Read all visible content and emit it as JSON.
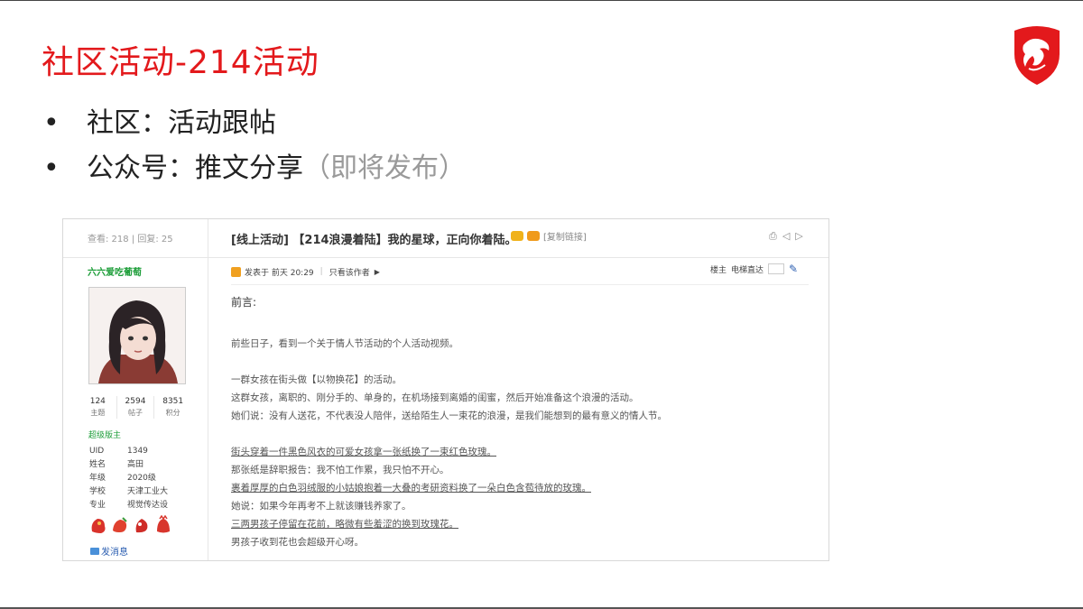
{
  "slide": {
    "title": "社区活动-214活动",
    "bullets": [
      {
        "main": "社区：活动跟帖",
        "muted": ""
      },
      {
        "main": "公众号：推文分享",
        "muted": "（即将发布）"
      }
    ],
    "accent_color": "#e3191c",
    "logo_icon": "msi-dragon-shield-icon"
  },
  "forum": {
    "stats": "查看: 218 | 回复: 25",
    "thread_title": "[线上活动] 【214浪漫着陆】我的星球，正向你着陆。",
    "copy_link": "[复制链接]",
    "author": "六六爱吃葡萄",
    "user_stats": [
      {
        "num": "124",
        "label": "主题"
      },
      {
        "num": "2594",
        "label": "帖子"
      },
      {
        "num": "8351",
        "label": "积分"
      }
    ],
    "rank": "超级版主",
    "profile": [
      {
        "key": "UID",
        "val": "1349"
      },
      {
        "key": "姓名",
        "val": "高田"
      },
      {
        "key": "年级",
        "val": "2020级"
      },
      {
        "key": "学校",
        "val": "天津工业大"
      },
      {
        "key": "专业",
        "val": "视觉传达设"
      }
    ],
    "send_message": "发消息",
    "posted": "发表于 前天 20:29",
    "only_author": "只看该作者",
    "floor": "楼主",
    "jump": "电梯直达",
    "content": {
      "foreword": "前言:",
      "paragraphs": [
        [
          "前些日子，看到一个关于情人节活动的个人活动视频。"
        ],
        [
          "一群女孩在街头做【以物换花】的活动。",
          "这群女孩，离职的、刚分手的、单身的，在机场接到离婚的闺蜜，然后开始准备这个浪漫的活动。",
          "她们说：没有人送花，不代表没人陪伴，送给陌生人一束花的浪漫，是我们能想到的最有意义的情人节。"
        ]
      ],
      "stories": [
        {
          "text": "街头穿着一件黑色风衣的可爱女孩拿一张纸换了一束红色玫瑰。",
          "underline": true
        },
        {
          "text": "那张纸是辞职报告：我不怕工作累，我只怕不开心。",
          "underline": false
        },
        {
          "text": "裹着厚厚的白色羽绒服的小姑娘抱着一大叠的考研资料换了一朵白色含苞待放的玫瑰。",
          "underline": true
        },
        {
          "text": "她说：如果今年再考不上就该赚钱养家了。",
          "underline": false
        },
        {
          "text": "三两男孩子停留在花前，略微有些羞涩的换到玫瑰花。",
          "underline": true
        },
        {
          "text": "男孩子收到花也会超级开心呀。",
          "underline": false
        }
      ]
    }
  }
}
